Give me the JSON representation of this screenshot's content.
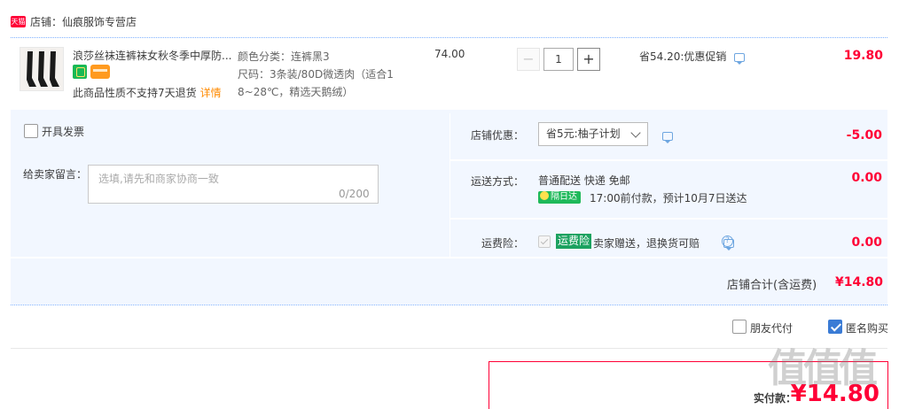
{
  "shop": {
    "badge": "天猫",
    "name": "店铺：仙痕服饰专营店"
  },
  "item": {
    "title": "浪莎丝袜连裤袜女秋冬季中厚防...",
    "no_return_text": "此商品性质不支持7天退货",
    "detail_link": "详情",
    "sku_lines": [
      "颜色分类：连裤黑3",
      "尺码：3条装/80D微透肉（适合1",
      "8~28℃，精选天鹅绒）"
    ],
    "unit_price": "74.00",
    "quantity": "1",
    "qty_minus": "−",
    "qty_plus": "+",
    "promo": "省54.20:优惠促销",
    "subtotal": "19.80"
  },
  "options": {
    "invoice_label": "开具发票",
    "memo_label": "给卖家留言：",
    "memo_placeholder": "选填,请先和商家协商一致",
    "memo_count": "0/200",
    "discount_label": "店铺优惠：",
    "discount_selected": "省5元:柚子计划",
    "discount_value": "-5.00",
    "shipping_label": "运送方式：",
    "shipping_method": "普通配送 快递 免邮",
    "nextday_badge": "隔日达",
    "shipping_eta": "17:00前付款，预计10月7日送达",
    "shipping_value": "0.00",
    "insurance_label": "运费险：",
    "insurance_badge": "运费险",
    "insurance_text": "卖家赠送，退换货可赔",
    "help": "?",
    "insurance_value": "0.00",
    "total_label": "店铺合计(含运费)",
    "total_value": "¥14.80"
  },
  "bottom": {
    "friend_pay_label": "朋友代付",
    "anon_label": "匿名购买",
    "pay_label": "实付款：",
    "pay_value": "¥14.80",
    "watermark": "值值值"
  }
}
